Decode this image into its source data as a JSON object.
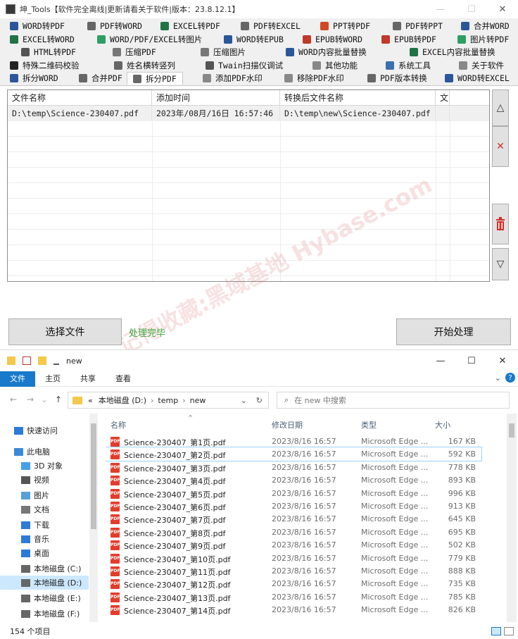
{
  "app": {
    "title": "坤_Tools【软件完全离线|更新请看关于软件|版本：23.8.12.1】",
    "window_controls": [
      "—",
      "☐",
      "✕"
    ],
    "tab_rows": [
      [
        {
          "label": "WORD转PDF",
          "icon": "word-icon"
        },
        {
          "label": "PDF转WORD",
          "icon": "pdf-icon"
        },
        {
          "label": "EXCEL转PDF",
          "icon": "excel-icon"
        },
        {
          "label": "PDF转EXCEL",
          "icon": "pdf-icon"
        },
        {
          "label": "PPT转PDF",
          "icon": "ppt-icon"
        },
        {
          "label": "PDF转PPT",
          "icon": "pdf-icon"
        },
        {
          "label": "合并WORD",
          "icon": "word-icon"
        }
      ],
      [
        {
          "label": "EXCEL转WORD",
          "icon": "excel-icon"
        },
        {
          "label": "WORD/PDF/EXCEL转图片",
          "icon": "image-icon"
        },
        {
          "label": "WORD转EPUB",
          "icon": "word-icon"
        },
        {
          "label": "EPUB转WORD",
          "icon": "epub-icon"
        },
        {
          "label": "EPUB转PDF",
          "icon": "epub-icon"
        },
        {
          "label": "图片转PDF",
          "icon": "image-icon"
        }
      ],
      [
        {
          "label": "HTML转PDF",
          "icon": "html-icon"
        },
        {
          "label": "压缩PDF",
          "icon": "compress-icon"
        },
        {
          "label": "压缩图片",
          "icon": "compress-icon"
        },
        {
          "label": "WORD内容批量替换",
          "icon": "word-icon"
        },
        {
          "label": "EXCEL内容批量替换",
          "icon": "excel-icon"
        }
      ],
      [
        {
          "label": "特殊二维码校验",
          "icon": "qrcode-icon"
        },
        {
          "label": "姓名横转竖列",
          "icon": "list-icon"
        },
        {
          "label": "Twain扫描仪调试",
          "icon": "scanner-icon"
        },
        {
          "label": "其他功能",
          "icon": "more-icon"
        },
        {
          "label": "系统工具",
          "icon": "gear-icon"
        },
        {
          "label": "关于软件",
          "icon": "info-icon"
        }
      ],
      [
        {
          "label": "拆分WORD",
          "icon": "word-icon"
        },
        {
          "label": "合并PDF",
          "icon": "pdf-icon"
        },
        {
          "label": "拆分PDF",
          "icon": "pdf-icon",
          "active": true
        },
        {
          "label": "添加PDF水印",
          "icon": "watermark-icon"
        },
        {
          "label": "移除PDF水印",
          "icon": "watermark-icon"
        },
        {
          "label": "PDF版本转换",
          "icon": "pdf-icon"
        },
        {
          "label": "WORD转EXCEL",
          "icon": "word-icon"
        }
      ]
    ],
    "grid": {
      "columns": [
        "文件名称",
        "添加时间",
        "转换后文件名称",
        "文"
      ],
      "rows": [
        {
          "file": "D:\\temp\\Science-230407.pdf",
          "time": "2023年/08月/16日 16:57:46",
          "output": "D:\\temp\\new\\Science-230407.pdf",
          "extra": ""
        }
      ]
    },
    "side_buttons": {
      "up": "△",
      "delete": "✕",
      "clear": "🗑",
      "down": "▽"
    },
    "select_button": "选择文件",
    "status_text": "处理完毕",
    "start_button": "开始处理",
    "watermark": "记得收藏:黑域基地 Hybase.com",
    "colors": {
      "word": "#2b579a",
      "excel": "#217346",
      "ppt": "#d24726",
      "pdf": "#b30b00",
      "status": "#3aa33a",
      "delete": "#d0302b"
    }
  },
  "explorer": {
    "title": "new",
    "window_controls": [
      "—",
      "☐",
      "✕"
    ],
    "ribbon": [
      "文件",
      "主页",
      "共享",
      "查看"
    ],
    "address": {
      "prefix": "«",
      "parts": [
        "本地磁盘 (D:)",
        "temp",
        "new"
      ]
    },
    "search_placeholder": "在 new 中搜索",
    "nav_items": [
      {
        "label": "快速访问",
        "icon": "star-icon"
      },
      {
        "label": "此电脑",
        "icon": "computer-icon"
      },
      {
        "label": "3D 对象",
        "icon": "cube-icon"
      },
      {
        "label": "视频",
        "icon": "video-icon"
      },
      {
        "label": "图片",
        "icon": "picture-icon"
      },
      {
        "label": "文档",
        "icon": "document-icon"
      },
      {
        "label": "下载",
        "icon": "download-icon"
      },
      {
        "label": "音乐",
        "icon": "music-icon"
      },
      {
        "label": "桌面",
        "icon": "desktop-icon"
      },
      {
        "label": "本地磁盘 (C:)",
        "icon": "drive-icon"
      },
      {
        "label": "本地磁盘 (D:)",
        "icon": "drive-icon",
        "selected": true
      },
      {
        "label": "本地磁盘 (E:)",
        "icon": "drive-icon"
      },
      {
        "label": "本地磁盘 (F:)",
        "icon": "drive-icon"
      }
    ],
    "columns": [
      "名称",
      "修改日期",
      "类型",
      "大小"
    ],
    "files": [
      {
        "name": "Science-230407_第1页.pdf",
        "date": "2023/8/16 16:57",
        "type": "Microsoft Edge ...",
        "size": "167 KB"
      },
      {
        "name": "Science-230407_第2页.pdf",
        "date": "2023/8/16 16:57",
        "type": "Microsoft Edge ...",
        "size": "592 KB",
        "selected": true
      },
      {
        "name": "Science-230407_第3页.pdf",
        "date": "2023/8/16 16:57",
        "type": "Microsoft Edge ...",
        "size": "778 KB"
      },
      {
        "name": "Science-230407_第4页.pdf",
        "date": "2023/8/16 16:57",
        "type": "Microsoft Edge ...",
        "size": "893 KB"
      },
      {
        "name": "Science-230407_第5页.pdf",
        "date": "2023/8/16 16:57",
        "type": "Microsoft Edge ...",
        "size": "996 KB"
      },
      {
        "name": "Science-230407_第6页.pdf",
        "date": "2023/8/16 16:57",
        "type": "Microsoft Edge ...",
        "size": "913 KB"
      },
      {
        "name": "Science-230407_第7页.pdf",
        "date": "2023/8/16 16:57",
        "type": "Microsoft Edge ...",
        "size": "645 KB"
      },
      {
        "name": "Science-230407_第8页.pdf",
        "date": "2023/8/16 16:57",
        "type": "Microsoft Edge ...",
        "size": "695 KB"
      },
      {
        "name": "Science-230407_第9页.pdf",
        "date": "2023/8/16 16:57",
        "type": "Microsoft Edge ...",
        "size": "502 KB"
      },
      {
        "name": "Science-230407_第10页.pdf",
        "date": "2023/8/16 16:57",
        "type": "Microsoft Edge ...",
        "size": "779 KB"
      },
      {
        "name": "Science-230407_第11页.pdf",
        "date": "2023/8/16 16:57",
        "type": "Microsoft Edge ...",
        "size": "888 KB"
      },
      {
        "name": "Science-230407_第12页.pdf",
        "date": "2023/8/16 16:57",
        "type": "Microsoft Edge ...",
        "size": "735 KB"
      },
      {
        "name": "Science-230407_第13页.pdf",
        "date": "2023/8/16 16:57",
        "type": "Microsoft Edge ...",
        "size": "785 KB"
      },
      {
        "name": "Science-230407_第14页.pdf",
        "date": "2023/8/16 16:57",
        "type": "Microsoft Edge ...",
        "size": "826 KB"
      }
    ],
    "item_count": "154 个项目"
  }
}
